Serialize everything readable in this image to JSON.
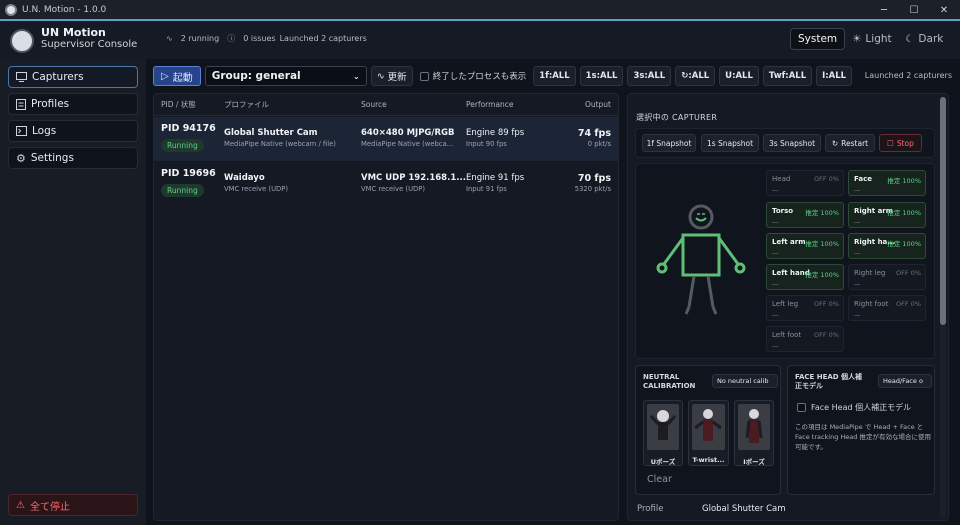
{
  "window": {
    "title": "U.N. Motion - 1.0.0"
  },
  "header": {
    "app_name": "UN Motion",
    "subtitle": "Supervisor Console",
    "running": "2 running",
    "issues": "0 issues",
    "message": "Launched 2 capturers",
    "themes": {
      "system": "System",
      "light": "Light",
      "dark": "Dark",
      "active": "System"
    }
  },
  "sidebar": {
    "items": [
      {
        "label": "Capturers",
        "icon": "monitor-icon"
      },
      {
        "label": "Profiles",
        "icon": "document-icon"
      },
      {
        "label": "Logs",
        "icon": "terminal-icon"
      },
      {
        "label": "Settings",
        "icon": "gear-icon"
      }
    ],
    "stop_all": "全て停止"
  },
  "toolbar": {
    "start": "起動",
    "group": "Group: general",
    "refresh": "更新",
    "show_exited": "終了したプロセスも表示",
    "snap_buttons": [
      "1f:ALL",
      "1s:ALL",
      "3s:ALL",
      "↻:ALL",
      "U:ALL",
      "Twf:ALL",
      "I:ALL"
    ],
    "status": "Launched 2 capturers"
  },
  "table": {
    "headers": {
      "pid": "PID / 状態",
      "profile": "プロファイル",
      "source": "Source",
      "performance": "Performance",
      "output": "Output"
    },
    "rows": [
      {
        "pid": "PID 94176",
        "status": "Running",
        "profile": "Global Shutter Cam",
        "profile_sub": "MediaPipe Native (webcam / file)",
        "source": "640×480 MJPG/RGB",
        "source_sub": "MediaPipe Native (webca...",
        "perf": "Engine 89 fps",
        "perf_sub": "Input 90 fps",
        "out": "74 fps",
        "out_sub": "0 pkt/s"
      },
      {
        "pid": "PID 19696",
        "status": "Running",
        "profile": "Waidayo",
        "profile_sub": "VMC receive (UDP)",
        "source": "VMC UDP 192.168.1...",
        "source_sub": "VMC receive (UDP)",
        "perf": "Engine 91 fps",
        "perf_sub": "Input 91 fps",
        "out": "70 fps",
        "out_sub": "5320 pkt/s"
      }
    ]
  },
  "panel": {
    "title": "選択中の CAPTURER",
    "actions": {
      "s1f": "1f Snapshot",
      "s1s": "1s Snapshot",
      "s3s": "3s Snapshot",
      "restart": "Restart",
      "stop": "Stop"
    },
    "parts": [
      {
        "name": "Head",
        "state": "OFF 0%",
        "detail": "—",
        "on": false
      },
      {
        "name": "Face",
        "state": "推定 100%",
        "detail": "—",
        "on": true
      },
      {
        "name": "Torso",
        "state": "推定 100%",
        "detail": "—",
        "on": true
      },
      {
        "name": "Right arm",
        "state": "推定 100%",
        "detail": "—",
        "on": true
      },
      {
        "name": "Left arm",
        "state": "推定 100%",
        "detail": "—",
        "on": true
      },
      {
        "name": "Right ha...",
        "state": "推定 100%",
        "detail": "—",
        "on": true
      },
      {
        "name": "Left hand",
        "state": "推定 100%",
        "detail": "—",
        "on": true
      },
      {
        "name": "Right leg",
        "state": "OFF 0%",
        "detail": "—",
        "on": false
      },
      {
        "name": "Left leg",
        "state": "OFF 0%",
        "detail": "—",
        "on": false
      },
      {
        "name": "Right foot",
        "state": "OFF 0%",
        "detail": "—",
        "on": false
      },
      {
        "name": "Left foot",
        "state": "OFF 0%",
        "detail": "—",
        "on": false
      }
    ],
    "neutral": {
      "title1": "NEUTRAL",
      "title2": "CALIBRATION",
      "badge": "No neutral calib",
      "poses": [
        "Uポーズ",
        "T-wrist...",
        "Iポーズ"
      ],
      "clear": "Clear"
    },
    "facehead": {
      "title1": "FACE HEAD 個人補",
      "title2": "正モデル",
      "badge": "Head/Face o",
      "checkbox": "Face Head 個人補正モデル",
      "desc": "この項目は MediaPipe で Head + Face と Face tracking Head 推定が有効な場合に使用可能です。"
    },
    "profile_label": "Profile",
    "profile_value": "Global Shutter Cam"
  },
  "colors": {
    "accent": "#5aa3c8",
    "running": "#5fd08a",
    "danger": "#ff6b73",
    "limb_on": "#5fbf78",
    "limb_off": "#555a63"
  }
}
